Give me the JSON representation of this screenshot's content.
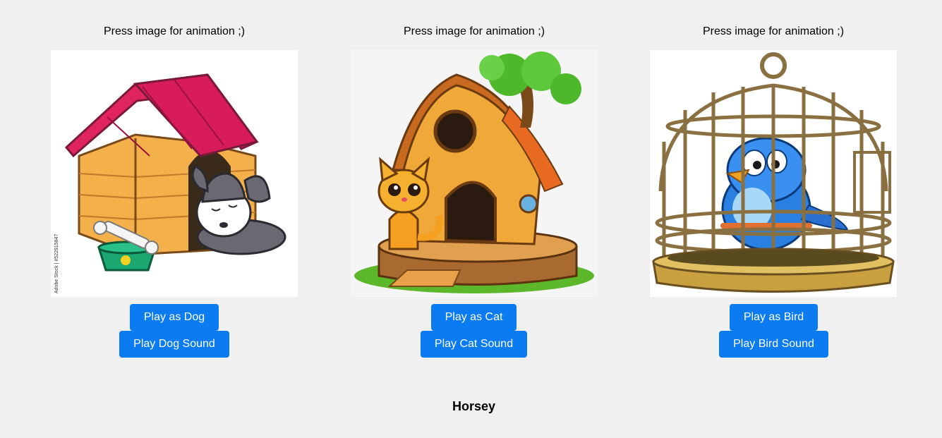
{
  "cards": [
    {
      "hint": "Press image for animation ;)",
      "image_label": "dog-in-doghouse",
      "play_as_label": "Play as Dog",
      "play_sound_label": "Play Dog Sound",
      "watermark": "Adobe Stock | #522915847"
    },
    {
      "hint": "Press image for animation ;)",
      "image_label": "cat-in-treehouse",
      "play_as_label": "Play as Cat",
      "play_sound_label": "Play Cat Sound"
    },
    {
      "hint": "Press image for animation ;)",
      "image_label": "bird-in-cage",
      "play_as_label": "Play as Bird",
      "play_sound_label": "Play Bird Sound"
    }
  ],
  "footer": {
    "title": "Horsey"
  },
  "colors": {
    "background": "#f0f0f0",
    "button": "#0a7bf0",
    "button_text": "#ffffff"
  }
}
